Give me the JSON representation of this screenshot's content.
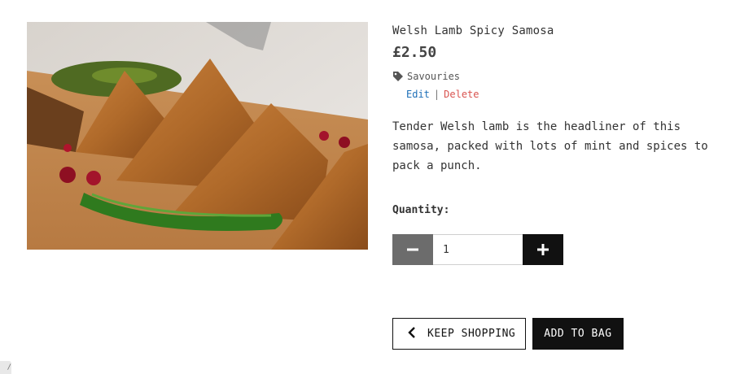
{
  "product": {
    "image_alt": "Welsh Lamb Spicy Samosa",
    "title": "Welsh Lamb Spicy Samosa",
    "price": "£2.50",
    "category": "Savouries",
    "description": "Tender Welsh lamb is the headliner of this samosa, packed with lots of mint and spices to pack a punch."
  },
  "admin": {
    "edit_label": "Edit",
    "separator": "|",
    "delete_label": "Delete"
  },
  "quantity": {
    "label": "Quantity:",
    "value": "1",
    "minus_icon": "minus-icon",
    "plus_icon": "plus-icon"
  },
  "actions": {
    "keep_shopping_label": "KEEP SHOPPING",
    "add_to_bag_label": "ADD TO BAG"
  },
  "corner_tag": "/",
  "colors": {
    "accent_dark": "#111111",
    "minus_button": "#6c6c6c",
    "edit_link": "#1d6fb8",
    "delete_link": "#d9534f"
  }
}
